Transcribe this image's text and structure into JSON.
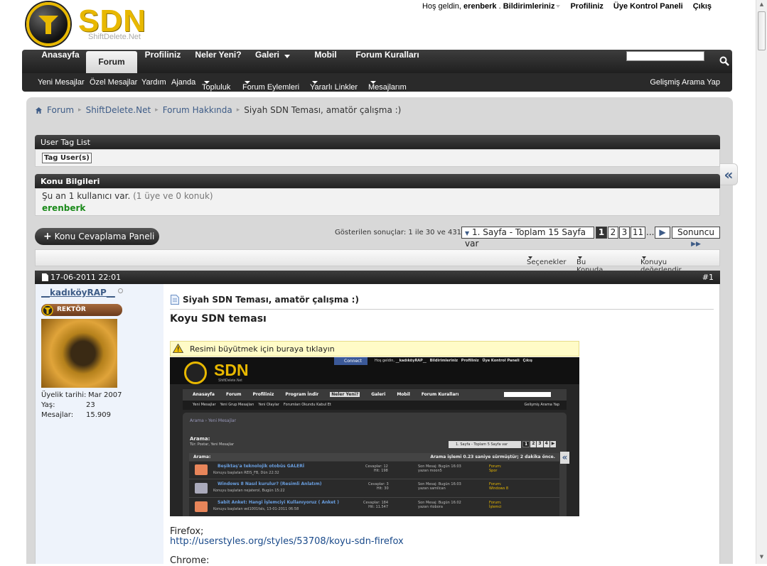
{
  "header": {
    "logo_text": "SDN",
    "logo_sub": "ShiftDelete.Net",
    "welcome": "Hoş geldin,",
    "username": "erenberk",
    "notifications": "Bildirimleriniz",
    "profile": "Profiliniz",
    "ucp": "Üye Kontrol Paneli",
    "logout": "Çıkış"
  },
  "nav": {
    "tabs": [
      "Anasayfa",
      "Forum",
      "Profiliniz",
      "Neler Yeni?",
      "Galeri",
      "Mobil",
      "Forum Kuralları"
    ],
    "active": "Forum",
    "subnav": [
      "Yeni Mesajlar",
      "Özel Mesajlar",
      "Yardım",
      "Ajanda",
      "Topluluk",
      "Forum Eylemleri",
      "Yararlı Linkler",
      "Mesajlarım"
    ],
    "advanced_search": "Gelişmiş Arama Yap"
  },
  "breadcrumb": {
    "items": [
      "Forum",
      "ShiftDelete.Net",
      "Forum Hakkında"
    ],
    "current": "Siyah SDN Teması, amatör çalışma :)"
  },
  "tag_list": {
    "title": "User Tag List",
    "button": "Tag User(s)"
  },
  "thread_info": {
    "title": "Konu Bilgileri",
    "line": "Şu an 1 kullanıcı var.",
    "detail": "(1 üye ve 0 konuk)",
    "user": "erenberk"
  },
  "reply_button": "Konu Cevaplama Paneli",
  "pagination": {
    "results": "Gösterilen sonuçlar: 1 ile 30 ve 431",
    "page_label": "1. Sayfa - Toplam 15 Sayfa var",
    "pages": [
      "1",
      "2",
      "3",
      "11"
    ],
    "ellipsis": "...",
    "last": "Sonuncu"
  },
  "toolbar": {
    "options": "Seçenekler",
    "search": "Bu Konuda Ara",
    "rate": "Konuyu değerlendir"
  },
  "post": {
    "date": "17-06-2011 22:01",
    "number": "#1",
    "author": "__kadıköyRAP__",
    "rank": "REKTÖR",
    "joined_label": "Üyelik tarihi:",
    "joined": "Mar 2007",
    "age_label": "Yaş:",
    "age": "23",
    "posts_label": "Mesajlar:",
    "posts": "15.909",
    "title": "Siyah SDN Teması, amatör çalışma :)",
    "heading": "Koyu SDN teması",
    "image_notice": "Resimi büyütmek için buraya tıklayın",
    "firefox_label": "Firefox;",
    "firefox_link": "http://userstyles.org/styles/53708/koyu-sdn-firefox",
    "chrome_label": "Chrome:"
  },
  "screenshot": {
    "connect": "Connect",
    "welcome": "Hoş geldin,",
    "user": "__kadıköyRAP__",
    "links": [
      "Bildirimleriniz",
      "Profiliniz",
      "Üye Kontrol Paneli",
      "Çıkış"
    ],
    "tabs": [
      "Anasayfa",
      "Forum",
      "Profiliniz",
      "Program İndir",
      "Neler Yeni?",
      "Galeri",
      "Mobil",
      "Forum Kuralları"
    ],
    "subnav": [
      "Yeni Mesajlar",
      "Yeni Grup Mesajları",
      "Yeni Olaylar",
      "Forumları Okundu Kabul Et"
    ],
    "adv": "Gelişmiş Arama Yap",
    "crumbs": "Arama  ›  Yeni Mesajlar",
    "search_title": "Arama:",
    "search_sub": "Tür: Postar, Yeni Mesajlar",
    "pager": "1. Sayfa - Toplam 5 Sayfa var",
    "bar_left": "Arama:",
    "bar_right": "Arama işlemi 0.23 saniye sürmüştür; 2 dakika önce.",
    "rows": [
      {
        "title": "Beşiktaş'a teknolojik otobüs GALERİ",
        "meta": "Konuyu başlatan REIS_FB, Dün 22:32",
        "stats": "Cevaplar: 12\nHit: 198",
        "last": "Son Mesaj: Bugün 16:03\nyazan moon5",
        "forum": "Forum:\nSpor"
      },
      {
        "title": "Windows 8 Nasıl kurulur? (Resimli Anlatım)",
        "meta": "Konuyu başlatan nejaterol, Bugün 15:22",
        "stats": "Cevaplar: 3\nHit: 30",
        "last": "Son Mesaj: Bugün 16:03\nyazan samilcan",
        "forum": "Forum:\nWindows 8"
      },
      {
        "title": "Sabit Anket: Hangi İşlemciyi Kullanıyoruz ( Anket )",
        "meta": "Konuyu başlatan wd1001fals, 13-01-2011 06:58",
        "stats": "Cevaplar: 184\nHit: 11.547",
        "last": "Son Mesaj: Bugün 16:02\nyazan rtobora",
        "forum": "Forum:\nİşlemci"
      }
    ]
  },
  "colors": {
    "accent": "#e8b800",
    "link": "#3e5c87",
    "user": "#1a8a1a"
  }
}
